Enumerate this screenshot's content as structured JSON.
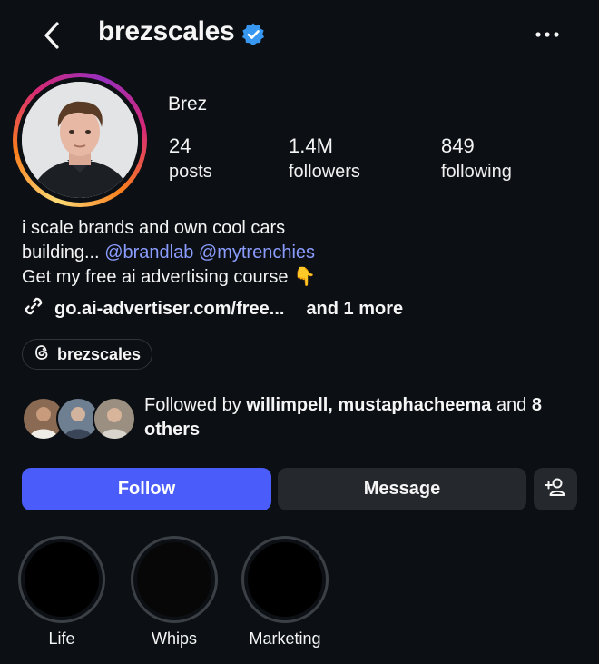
{
  "header": {
    "username": "brezscales",
    "icons": [
      "chevron-left-icon",
      "verified-badge-icon",
      "more-horizontal-icon"
    ]
  },
  "profile": {
    "display_name": "Brez",
    "stats": [
      {
        "value": "24",
        "label": "posts"
      },
      {
        "value": "1.4M",
        "label": "followers"
      },
      {
        "value": "849",
        "label": "following"
      }
    ]
  },
  "bio": {
    "line1": "i scale brands and own cool cars",
    "line2_prefix": "building...",
    "mention1": "@brandlab",
    "mention2": "@mytrenchies",
    "line3": "Get my free ai advertising course",
    "line3_emoji": "👇",
    "link": "go.ai-advertiser.com/free...",
    "link_more": "and 1 more"
  },
  "threads": {
    "label": "brezscales",
    "icon": "threads-icon"
  },
  "followed_by": {
    "prefix": "Followed by",
    "names": "willimpell, mustaphacheema",
    "and": "and",
    "others": "8 others"
  },
  "actions": {
    "follow": "Follow",
    "message": "Message",
    "add_user_icon": "add-user-icon"
  },
  "highlights": [
    {
      "label": "Life"
    },
    {
      "label": "Whips"
    },
    {
      "label": "Marketing"
    }
  ],
  "colors": {
    "background": "#0c1014",
    "follow_button": "#4a5dfa",
    "secondary_button": "#25292e",
    "mention": "#8b9cff",
    "verified": "#3897f0"
  }
}
